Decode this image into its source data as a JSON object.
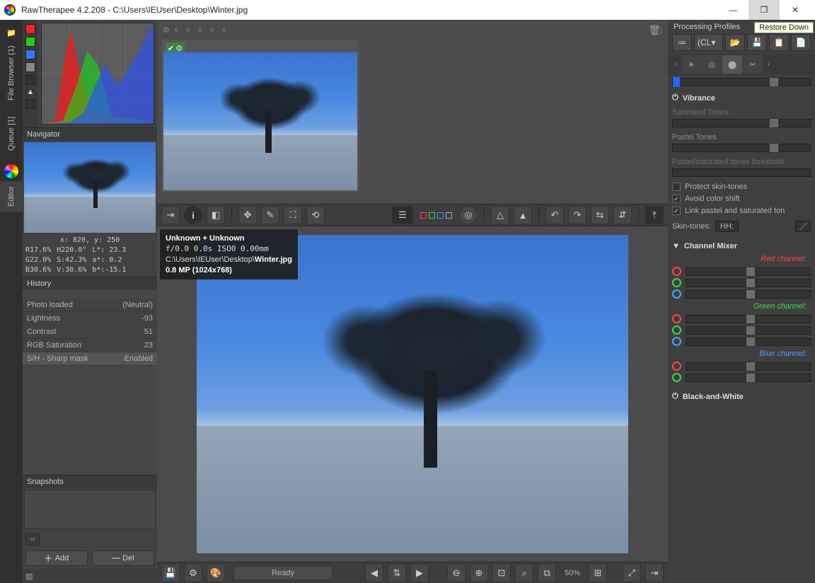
{
  "app": {
    "title": "RawTherapee 4.2.208 - C:\\Users\\IEUser\\Desktop\\Winter.jpg",
    "tooltip_restore": "Restore Down"
  },
  "vtabs": {
    "file_browser": "File Browser (1)",
    "queue": "Queue [1]",
    "editor": "Editor"
  },
  "navigator": {
    "title": "Navigator",
    "coords": "x: 820, y: 250",
    "r": "R17.6%",
    "h": "H220.0°",
    "l": "L*: 23.3",
    "g": "G22.0%",
    "s": "S:42.3%",
    "a": "a*:  0.2",
    "b": "B30.6%",
    "v": "V:30.6%",
    "bstar": "b*:-15.1"
  },
  "history": {
    "title": "History",
    "items": [
      {
        "label": "Photo loaded",
        "value": "(Neutral)"
      },
      {
        "label": "Lightness",
        "value": "-93"
      },
      {
        "label": "Contrast",
        "value": "51"
      },
      {
        "label": "RGB Saturation",
        "value": "23"
      },
      {
        "label": "S/H - Sharp mask",
        "value": "Enabled"
      }
    ]
  },
  "snapshots": {
    "title": "Snapshots",
    "add": "Add",
    "del": "Del"
  },
  "info_overlay": {
    "line1": "Unknown + Unknown",
    "line2": "f/0.0  0.0s  ISO0  0.00mm",
    "path_pre": "C:\\Users\\IEUser\\Desktop\\",
    "filename": "Winter.jpg",
    "line3": "0.8 MP (1024x768)"
  },
  "bottom": {
    "ready": "Ready",
    "zoom_pct": "50%"
  },
  "right": {
    "profiles_title": "Processing Profiles",
    "prof_dropdown": "(CL",
    "vibrance": {
      "title": "Vibrance",
      "saturated": "Saturated Tones",
      "pastel": "Pastel Tones",
      "threshold": "Pastel/saturated tones threshold",
      "protect_skin": "Protect skin-tones",
      "avoid_shift": "Avoid color shift",
      "link_pastel": "Link pastel and saturated ton",
      "skintones_label": "Skin-tones:",
      "skintones_value": "HH:"
    },
    "chmix": {
      "title": "Channel Mixer",
      "red": "Red channel:",
      "green": "Green channel:",
      "blue": "Blue channel:"
    },
    "bw": {
      "title": "Black-and-White"
    }
  }
}
